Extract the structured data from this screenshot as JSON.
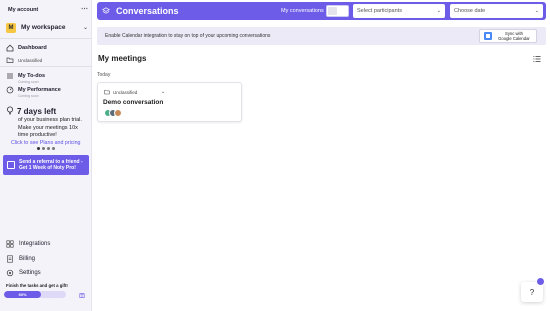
{
  "sidebar": {
    "account_label": "My account",
    "workspace": {
      "badge": "M",
      "name": "My workspace"
    },
    "nav": {
      "dashboard": "Dashboard",
      "unclassified": "Unclassified",
      "todos": "My To-dos",
      "todos_note": "Coming soon",
      "performance": "My Performance",
      "performance_note": "Coming soon"
    },
    "trial": {
      "headline": "7 days left",
      "line1": "of your business plan trial.",
      "line2": "Make your meetings 10x",
      "line3": "time productive!",
      "link": "Click to see Plans and pricing"
    },
    "referral": {
      "line1": "Send a referral to a friend -",
      "line2": "Get 1 Week of Noty Pro!"
    },
    "bottom": {
      "integrations": "Integrations",
      "billing": "Billing",
      "settings": "Settings"
    },
    "tasks": {
      "label": "Finish the tasks and get a gift!",
      "progress_text": "60%",
      "progress_fraction": 0.6
    }
  },
  "header": {
    "title": "Conversations",
    "my_conversations_label": "My conversations",
    "participants_placeholder": "Select participants",
    "date_placeholder": "Choose date"
  },
  "banner": {
    "text": "Enable Calendar integration to stay on top of your upcoming conversations",
    "sync_line1": "Sync with",
    "sync_line2": "Google Calendar"
  },
  "main": {
    "section_title": "My meetings",
    "group_label": "Today",
    "cards": [
      {
        "folder": "Unclassified",
        "title": "Demo conversation"
      }
    ]
  },
  "help": {
    "label": "?"
  },
  "colors": {
    "accent": "#6c5ce7",
    "sidebar_bg": "#f4f3f9"
  }
}
